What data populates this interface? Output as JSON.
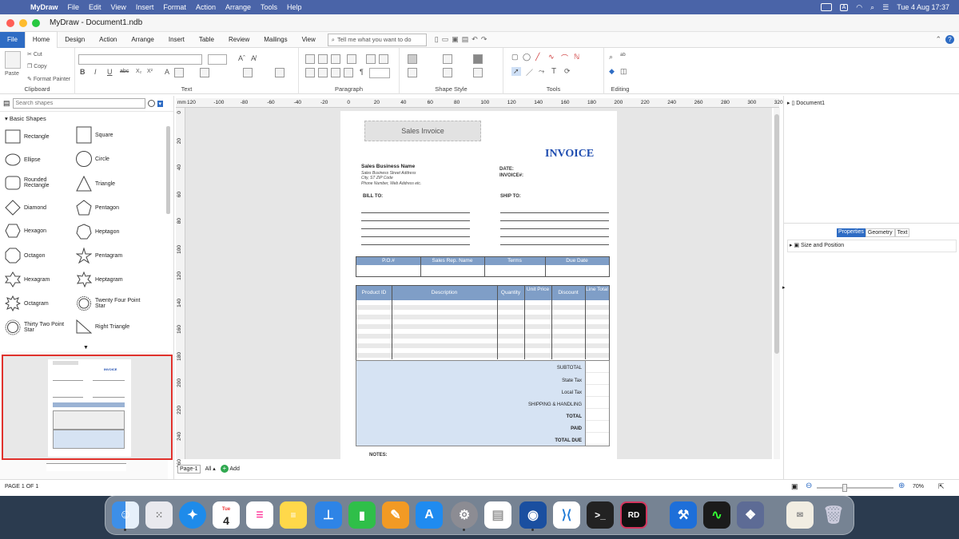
{
  "menubar": {
    "app_name": "MyDraw",
    "items": [
      "File",
      "Edit",
      "View",
      "Insert",
      "Format",
      "Action",
      "Arrange",
      "Tools",
      "Help"
    ],
    "datetime": "Tue 4 Aug  17:37",
    "input_badge": "A"
  },
  "window": {
    "title": "MyDraw - Document1.ndb"
  },
  "ribbon_tabs": [
    "File",
    "Home",
    "Design",
    "Action",
    "Arrange",
    "Insert",
    "Table",
    "Review",
    "Mailings",
    "View"
  ],
  "active_tab": "Home",
  "tell_me": "Tell me what you want to do",
  "ribbon": {
    "clipboard": {
      "cut": "Cut",
      "copy": "Copy",
      "paste": "Paste",
      "format_painter": "Format Painter",
      "label": "Clipboard"
    },
    "text_label": "Text",
    "paragraph_label": "Paragraph",
    "shape_style_label": "Shape Style",
    "tools_label": "Tools",
    "editing_label": "Editing",
    "format_glyphs": [
      "B",
      "I",
      "U",
      "abc",
      "X₂",
      "X²",
      "A"
    ]
  },
  "left_pane": {
    "search_placeholder": "Search shapes",
    "section": "Basic Shapes",
    "shapes": [
      {
        "label": "Rectangle",
        "icon": "rectangle"
      },
      {
        "label": "Square",
        "icon": "square"
      },
      {
        "label": "Ellipse",
        "icon": "ellipse"
      },
      {
        "label": "Circle",
        "icon": "circle"
      },
      {
        "label": "Rounded Rectangle",
        "icon": "rounded-rectangle"
      },
      {
        "label": "Triangle",
        "icon": "triangle"
      },
      {
        "label": "Diamond",
        "icon": "diamond"
      },
      {
        "label": "Pentagon",
        "icon": "pentagon"
      },
      {
        "label": "Hexagon",
        "icon": "hexagon"
      },
      {
        "label": "Heptagon",
        "icon": "heptagon"
      },
      {
        "label": "Octagon",
        "icon": "octagon"
      },
      {
        "label": "Pentagram",
        "icon": "pentagram"
      },
      {
        "label": "Hexagram",
        "icon": "hexagram"
      },
      {
        "label": "Heptagram",
        "icon": "heptagram"
      },
      {
        "label": "Octagram",
        "icon": "octagram"
      },
      {
        "label": "Twenty Four Point Star",
        "icon": "star-24"
      },
      {
        "label": "Thirty Two Point Star",
        "icon": "star-32"
      },
      {
        "label": "Right Triangle",
        "icon": "right-triangle"
      }
    ]
  },
  "ruler": {
    "unit": "mm",
    "h_ticks": [
      "120",
      "-100",
      "-80",
      "-60",
      "-40",
      "-20",
      "0",
      "20",
      "40",
      "60",
      "80",
      "100",
      "120",
      "140",
      "160",
      "180",
      "200",
      "220",
      "240",
      "260",
      "280",
      "300",
      "320"
    ],
    "v_ticks": [
      "0",
      "20",
      "40",
      "60",
      "80",
      "100",
      "120",
      "140",
      "160",
      "180",
      "200",
      "220",
      "240",
      "260"
    ]
  },
  "invoice": {
    "banner": "Sales Invoice",
    "heading": "INVOICE",
    "business_name": "Sales Business Name",
    "address_lines": [
      "Sales Business Street Address",
      "City, ST ZIP Code",
      "Phone Number, Web Address etc."
    ],
    "date_label": "DATE:",
    "invoice_no_label": "INVOICE#:",
    "bill_to": "BILL TO:",
    "ship_to": "SHIP TO:",
    "meta_headers": [
      "P.O.#",
      "Sales Rep. Name",
      "Terms",
      "Due Date"
    ],
    "item_headers": [
      "Product ID",
      "Description",
      "Quantity",
      "Unit Price",
      "Discount",
      "Line Total"
    ],
    "totals": [
      "SUBTOTAL",
      "State Tax",
      "Local Tax",
      "SHIPPING & HANDLING",
      "TOTAL",
      "PAID",
      "TOTAL DUE"
    ],
    "notes": "NOTES:"
  },
  "pager": {
    "page_tab": "Page-1",
    "all": "All",
    "add": "Add"
  },
  "right_pane": {
    "tree_item": "Document1",
    "tabs": [
      "Properties",
      "Geometry",
      "Text"
    ],
    "active_tab": "Properties",
    "prop_item": "Size and Position"
  },
  "status": {
    "page_info": "PAGE 1 OF 1",
    "zoom": "70%"
  },
  "dock": {
    "calendar_month": "Tue",
    "calendar_day": "4",
    "rd_label": "RD",
    "apps": [
      "finder",
      "launchpad",
      "safari",
      "calendar",
      "reminders",
      "notes",
      "keynote",
      "numbers",
      "pages",
      "app-store",
      "system-preferences",
      "textedit",
      "mydraw",
      "vscode",
      "terminal",
      "rider",
      "xcode",
      "activity-monitor",
      "organizer",
      "certificate",
      "trash"
    ]
  },
  "colors": {
    "accent": "#2e6cc4",
    "table_header": "#7f9ec7",
    "summary_fill": "#d6e3f3",
    "invoice_heading": "#1f4db0",
    "selection": "#e0312c"
  }
}
